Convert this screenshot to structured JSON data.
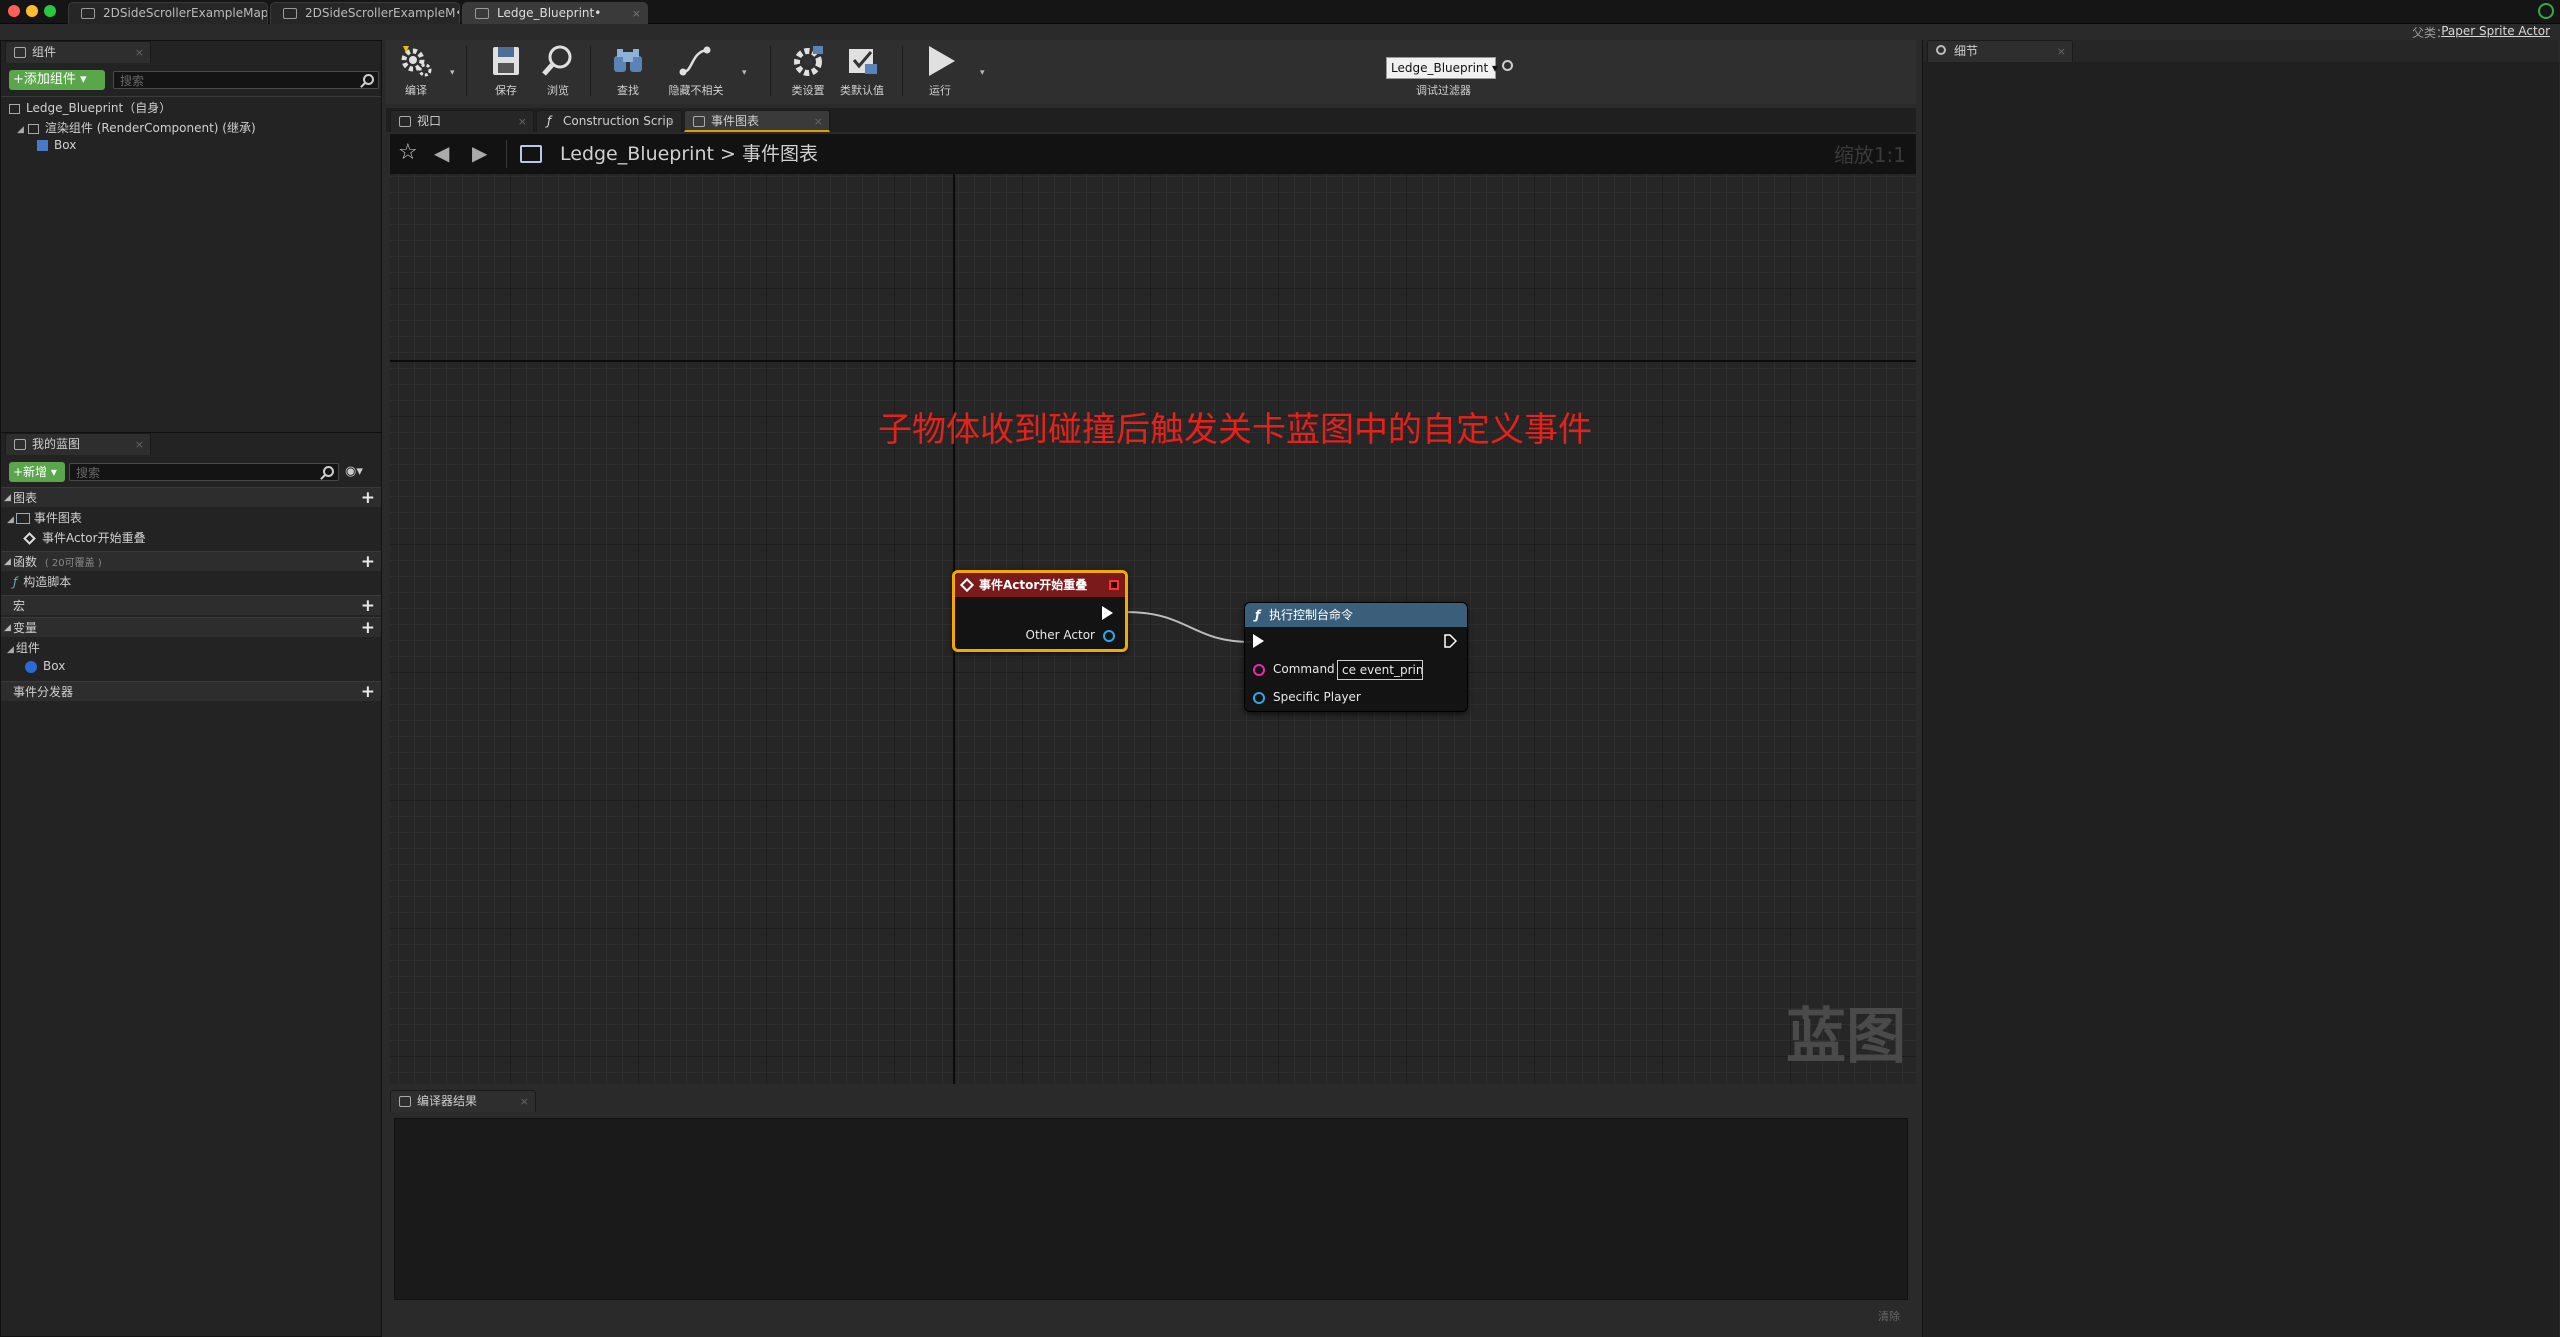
{
  "document_tabs": [
    {
      "label": "2DSideScrollerExampleMap•",
      "active": false
    },
    {
      "label": "2DSideScrollerExampleM•",
      "active": false
    },
    {
      "label": "Ledge_Blueprint•",
      "active": true
    }
  ],
  "parent_class": {
    "label": "父类：",
    "value": "Paper Sprite Actor"
  },
  "components_panel": {
    "tab_label": "组件",
    "add_component_label": "+添加组件 ▾",
    "search_placeholder": "搜索",
    "root_label": "Ledge_Blueprint（自身）",
    "items": [
      {
        "label": "渲染组件 (RenderComponent) (继承)"
      },
      {
        "label": "Box"
      }
    ]
  },
  "my_blueprint_panel": {
    "tab_label": "我的蓝图",
    "new_label": "+新增 ▾",
    "search_placeholder": "搜索",
    "graphs_label": "图表",
    "event_graph_label": "事件图表",
    "event_item_label": "事件Actor开始重叠",
    "functions_label": "函数",
    "functions_hint": "( 20可覆盖 )",
    "construction_script_label": "构造脚本",
    "macros_label": "宏",
    "variables_label": "变量",
    "components_label": "组件",
    "box_label": "Box",
    "dispatchers_label": "事件分发器"
  },
  "toolbar": {
    "compile": "编译",
    "save": "保存",
    "browse": "浏览",
    "find": "查找",
    "hide_unrelated": "隐藏不相关",
    "class_settings": "类设置",
    "class_defaults": "类默认值",
    "play": "运行",
    "debug_object": "Ledge_Blueprint ▾",
    "debug_filter_label": "调试过滤器"
  },
  "graph_tabs": [
    {
      "label": "视口",
      "active": false
    },
    {
      "label": "Construction Scrip",
      "active": false
    },
    {
      "label": "事件图表",
      "active": true
    }
  ],
  "graph_header": {
    "blueprint_name": "Ledge_Blueprint",
    "separator": ">",
    "graph_name": "事件图表",
    "zoom": "缩放1:1"
  },
  "graph": {
    "comment_text": "子物体收到碰撞后触发关卡蓝图中的自定义事件",
    "watermark": "蓝图",
    "event_node": {
      "title": "事件Actor开始重叠",
      "pin_other_actor": "Other Actor",
      "header_color": "#7a1a1a",
      "border_color": "#f5a800"
    },
    "command_node": {
      "title": "执行控制台命令",
      "pin_command": "Command",
      "command_value": "ce event_print",
      "pin_specific_player": "Specific Player",
      "header_color": "#3b5f7a"
    },
    "wire_color": "#bdbdbd",
    "object_pin_color": "#2aa8e8",
    "string_pin_color": "#e82ab0"
  },
  "compiler_panel": {
    "tab_label": "编译器结果",
    "clear_label": "清除"
  },
  "details_panel": {
    "tab_label": "细节"
  }
}
